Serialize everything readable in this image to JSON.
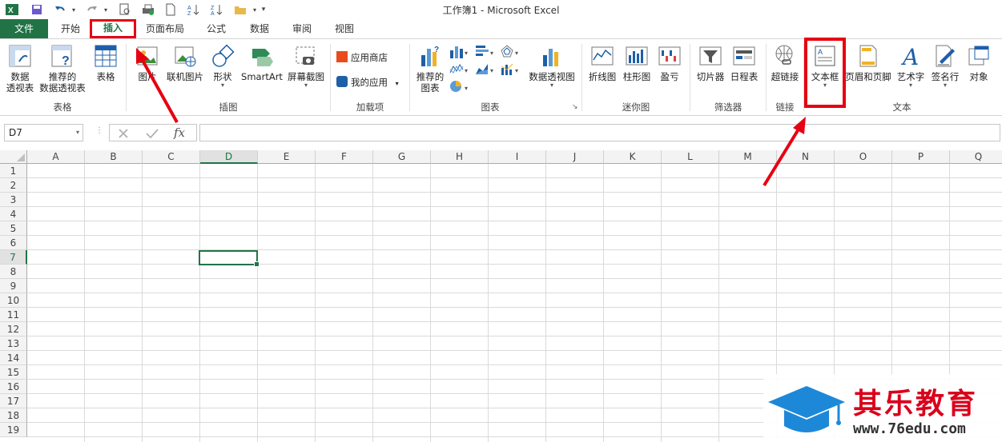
{
  "window": {
    "title": "工作簿1 - Microsoft Excel"
  },
  "quick_access": [
    "excel-logo-icon",
    "save-icon",
    "undo-icon",
    "redo-icon",
    "print-preview-icon",
    "quick-print-icon",
    "new-icon",
    "sort-asc-icon",
    "sort-desc-icon",
    "open-icon",
    "customize-icon"
  ],
  "tabs": [
    "文件",
    "开始",
    "插入",
    "页面布局",
    "公式",
    "数据",
    "审阅",
    "视图"
  ],
  "ribbon": {
    "groups": {
      "tables": "表格",
      "illustrations": "插图",
      "addins": "加载项",
      "charts": "图表",
      "sparklines": "迷你图",
      "filters": "筛选器",
      "links": "链接",
      "text": "文本"
    },
    "buttons": {
      "pivot_table_1": "数据",
      "pivot_table_2": "透视表",
      "rec_pivot_1": "推荐的",
      "rec_pivot_2": "数据透视表",
      "table": "表格",
      "pictures": "图片",
      "online_pictures": "联机图片",
      "shapes": "形状",
      "smartart": "SmartArt",
      "screenshot": "屏幕截图",
      "app_store": "应用商店",
      "my_apps": "我的应用",
      "rec_charts_1": "推荐的",
      "rec_charts_2": "图表",
      "pivot_chart": "数据透视图",
      "line_spark": "折线图",
      "column_spark": "柱形图",
      "winloss_spark": "盈亏",
      "slicer": "切片器",
      "timeline": "日程表",
      "hyperlink": "超链接",
      "textbox": "文本框",
      "header_footer": "页眉和页脚",
      "wordart": "艺术字",
      "signature": "签名行",
      "object": "对象"
    }
  },
  "formula_bar": {
    "name_box": "D7",
    "fx": "fx",
    "value": ""
  },
  "grid": {
    "columns": [
      "A",
      "B",
      "C",
      "D",
      "E",
      "F",
      "G",
      "H",
      "I",
      "J",
      "K",
      "L",
      "M",
      "N",
      "O",
      "P",
      "Q"
    ],
    "rows": [
      "1",
      "2",
      "3",
      "4",
      "5",
      "6",
      "7",
      "8",
      "9",
      "10",
      "11",
      "12",
      "13",
      "14",
      "15",
      "16",
      "17",
      "18",
      "19"
    ],
    "active_cell": "D7"
  },
  "watermark": {
    "brand": "其乐教育",
    "url": "www.76edu.com"
  },
  "colors": {
    "excel_green": "#217346",
    "highlight_red": "#e60012",
    "brand_blue": "#1e88d8",
    "brand_red": "#d9001b"
  }
}
